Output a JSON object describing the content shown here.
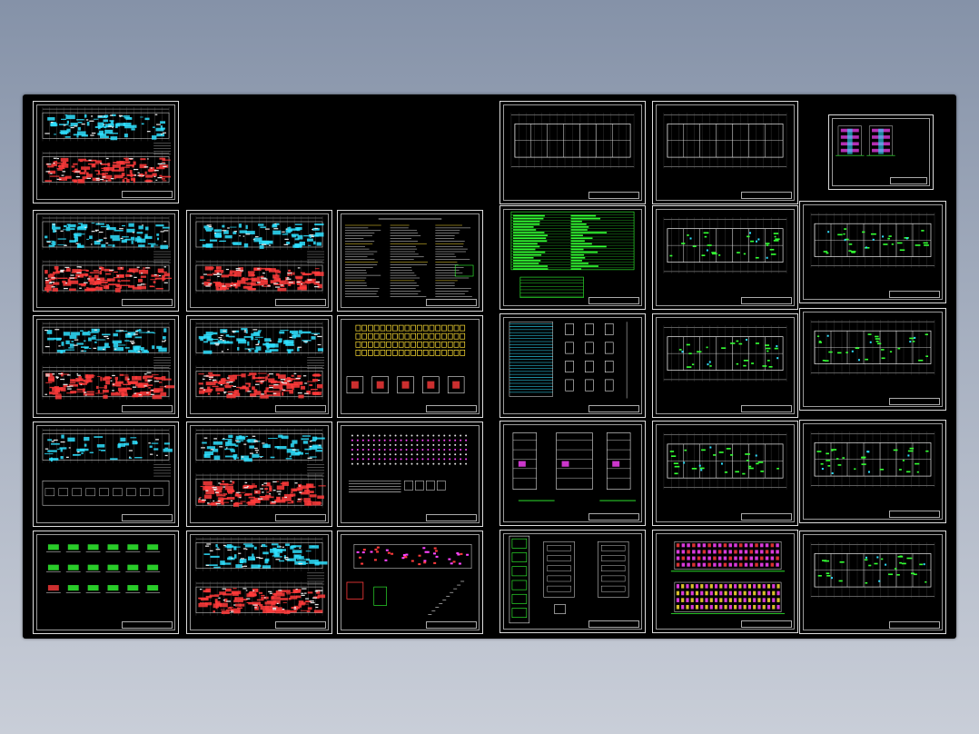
{
  "app": {
    "title": ""
  },
  "colors": {
    "background": "#000000",
    "frame": "#dcdcdc",
    "red": "#ff3b3b",
    "cyan": "#2fe0ff",
    "green": "#33ff33",
    "yellow": "#ffe033",
    "magenta": "#ff44ff",
    "white": "#e6e6e6"
  },
  "sheets": [
    {
      "id": "s1",
      "kind": "structural-plan",
      "label": ""
    },
    {
      "id": "s2",
      "kind": "structural-plan",
      "label": ""
    },
    {
      "id": "s3",
      "kind": "structural-plan",
      "label": ""
    },
    {
      "id": "s4",
      "kind": "notes",
      "label": ""
    },
    {
      "id": "s5",
      "kind": "structural-plan",
      "label": ""
    },
    {
      "id": "s6",
      "kind": "structural-plan",
      "label": ""
    },
    {
      "id": "s7",
      "kind": "foundation",
      "label": ""
    },
    {
      "id": "s8",
      "kind": "structural-plan-light",
      "label": ""
    },
    {
      "id": "s9",
      "kind": "structural-plan",
      "label": ""
    },
    {
      "id": "s10",
      "kind": "pile-layout",
      "label": ""
    },
    {
      "id": "s11",
      "kind": "details",
      "label": ""
    },
    {
      "id": "s12",
      "kind": "structural-plan",
      "label": ""
    },
    {
      "id": "s13",
      "kind": "stair-details",
      "label": ""
    },
    {
      "id": "a1",
      "kind": "arch-plan-white",
      "label": ""
    },
    {
      "id": "a2",
      "kind": "arch-plan-white",
      "label": ""
    },
    {
      "id": "a3",
      "kind": "elevation-small",
      "label": ""
    },
    {
      "id": "a4",
      "kind": "green-table",
      "label": ""
    },
    {
      "id": "a5",
      "kind": "arch-plan",
      "label": ""
    },
    {
      "id": "a6",
      "kind": "arch-plan",
      "label": ""
    },
    {
      "id": "a7",
      "kind": "door-window-table",
      "label": ""
    },
    {
      "id": "a8",
      "kind": "arch-plan",
      "label": ""
    },
    {
      "id": "a9",
      "kind": "arch-plan",
      "label": ""
    },
    {
      "id": "a10",
      "kind": "sections",
      "label": ""
    },
    {
      "id": "a11",
      "kind": "arch-plan",
      "label": ""
    },
    {
      "id": "a12",
      "kind": "arch-plan",
      "label": ""
    },
    {
      "id": "a13",
      "kind": "wall-sections",
      "label": ""
    },
    {
      "id": "a14",
      "kind": "elevations",
      "label": ""
    },
    {
      "id": "a15",
      "kind": "arch-plan",
      "label": ""
    }
  ]
}
